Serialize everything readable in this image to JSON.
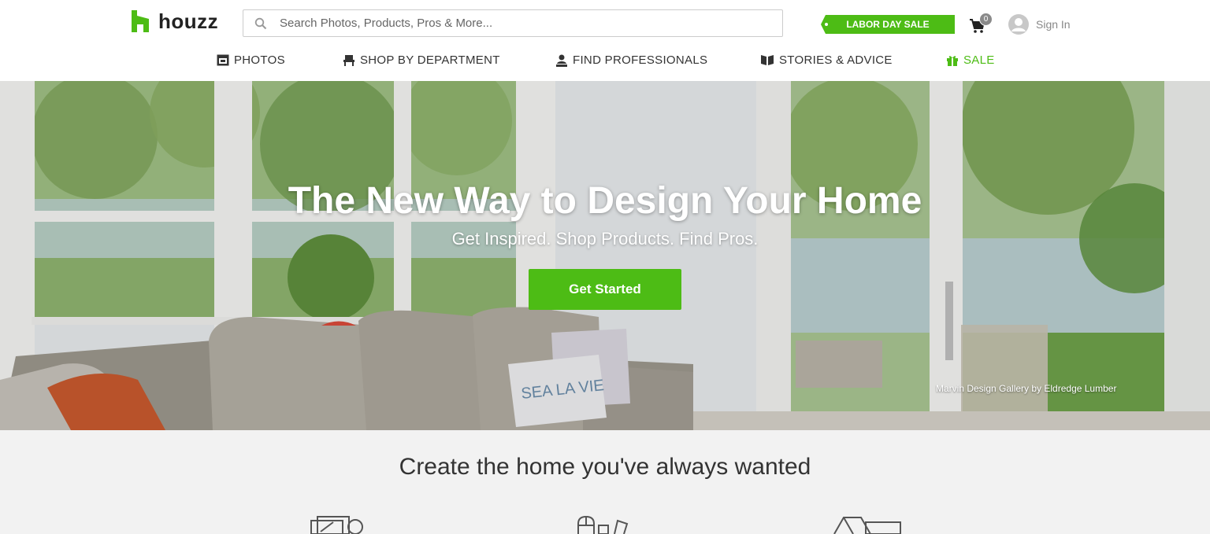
{
  "brand": {
    "name": "houzz",
    "accent": "#4dbc15"
  },
  "search": {
    "placeholder": "Search Photos, Products, Pros & More..."
  },
  "promo": {
    "label": "LABOR DAY SALE"
  },
  "cart": {
    "count": "0",
    "icon": "cart-icon"
  },
  "account": {
    "signin_label": "Sign In",
    "icon": "user-avatar-icon"
  },
  "nav": {
    "items": [
      {
        "label": "PHOTOS",
        "icon": "photos-icon"
      },
      {
        "label": "SHOP BY DEPARTMENT",
        "icon": "chair-icon"
      },
      {
        "label": "FIND PROFESSIONALS",
        "icon": "professional-icon"
      },
      {
        "label": "STORIES & ADVICE",
        "icon": "book-icon"
      },
      {
        "label": "SALE",
        "icon": "gift-icon"
      }
    ]
  },
  "hero": {
    "title": "The New Way to Design Your Home",
    "subtitle": "Get Inspired. Shop Products. Find Pros.",
    "cta_label": "Get Started",
    "photo_credit": "Marvin Design Gallery by Eldredge Lumber"
  },
  "section": {
    "title": "Create the home you've always wanted",
    "features": [
      {
        "icon": "photos-outline-icon"
      },
      {
        "icon": "products-outline-icon"
      },
      {
        "icon": "house-outline-icon"
      }
    ]
  }
}
